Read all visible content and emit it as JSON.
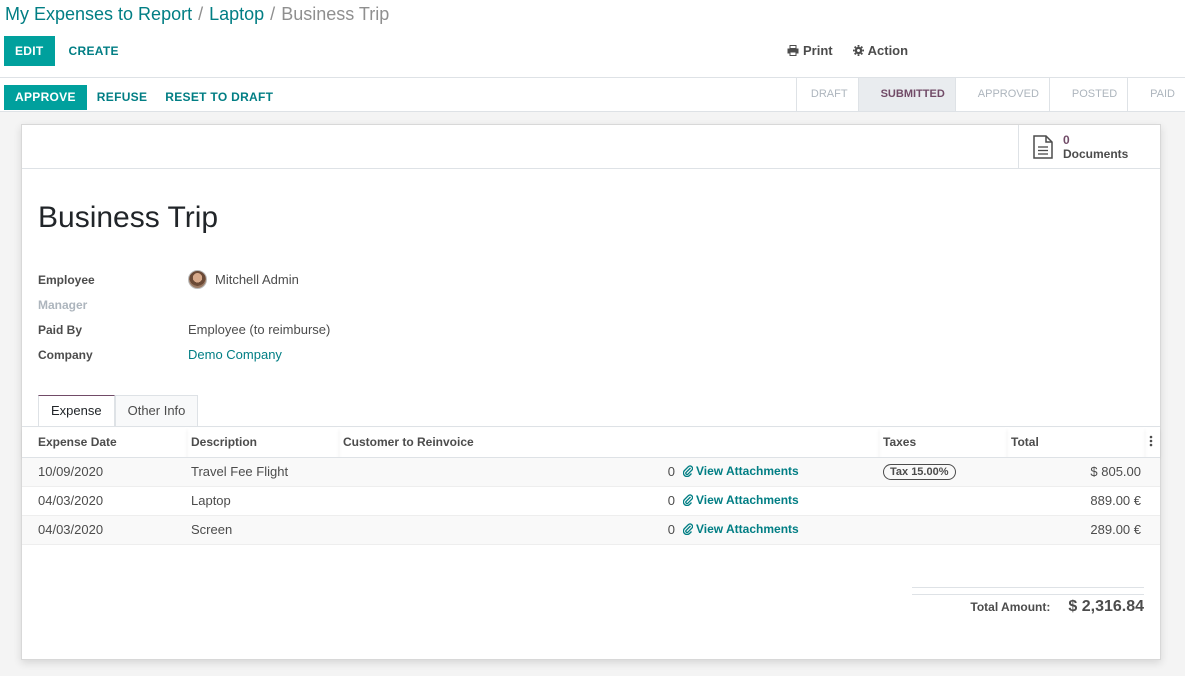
{
  "breadcrumb": {
    "items": [
      "My Expenses to Report",
      "Laptop"
    ],
    "current": "Business Trip"
  },
  "toolbar": {
    "edit_label": "EDIT",
    "create_label": "CREATE",
    "print_label": "Print",
    "action_label": "Action"
  },
  "statusbar": {
    "approve_label": "APPROVE",
    "refuse_label": "REFUSE",
    "reset_label": "RESET TO DRAFT",
    "steps": [
      "DRAFT",
      "SUBMITTED",
      "APPROVED",
      "POSTED",
      "PAID"
    ],
    "active_step": "SUBMITTED"
  },
  "documents": {
    "count": "0",
    "label": "Documents"
  },
  "record": {
    "title": "Business Trip",
    "fields": {
      "employee_label": "Employee",
      "employee_value": "Mitchell Admin",
      "manager_label": "Manager",
      "paid_by_label": "Paid By",
      "paid_by_value": "Employee (to reimburse)",
      "company_label": "Company",
      "company_value": "Demo Company"
    }
  },
  "tabs": [
    "Expense",
    "Other Info"
  ],
  "table": {
    "columns": [
      "Expense Date",
      "Description",
      "Customer to Reinvoice",
      "Taxes",
      "Total"
    ],
    "rows": [
      {
        "date": "10/09/2020",
        "description": "Travel Fee Flight",
        "qty": "0",
        "attachments": "View Attachments",
        "tax": "Tax 15.00%",
        "total": "$ 805.00"
      },
      {
        "date": "04/03/2020",
        "description": "Laptop",
        "qty": "0",
        "attachments": "View Attachments",
        "tax": "",
        "total": "889.00 €"
      },
      {
        "date": "04/03/2020",
        "description": "Screen",
        "qty": "0",
        "attachments": "View Attachments",
        "tax": "",
        "total": "289.00 €"
      }
    ]
  },
  "totals": {
    "label": "Total Amount:",
    "value": "$ 2,316.84"
  },
  "colors": {
    "accent": "#00a09d",
    "link": "#017e84",
    "brand": "#714b67"
  }
}
